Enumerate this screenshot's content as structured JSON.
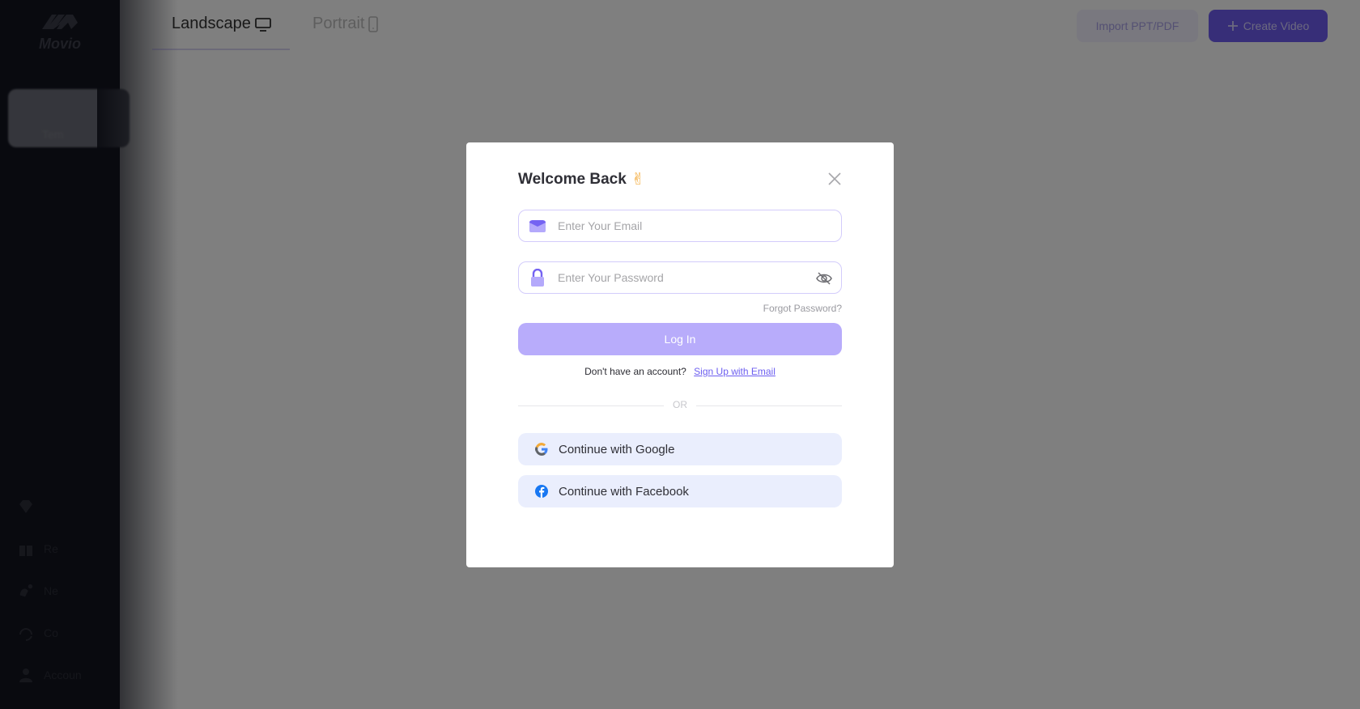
{
  "app": {
    "logo_text": "Movio"
  },
  "sidebar": {
    "active_item_label": "Tem",
    "bottom_items": [
      {
        "icon": "diamond-icon",
        "label": ""
      },
      {
        "icon": "gift-icon",
        "label": "Re"
      },
      {
        "icon": "affiliate-icon",
        "label": "Ne"
      },
      {
        "icon": "headset-icon",
        "label": "Co"
      },
      {
        "icon": "user-icon",
        "label": "Accoun"
      }
    ]
  },
  "topbar": {
    "tabs": [
      {
        "label": "Landscape",
        "icon": "monitor-icon",
        "active": true
      },
      {
        "label": "Portrait",
        "icon": "phone-icon",
        "active": false
      }
    ],
    "import_label": "Import PPT/PDF",
    "create_label": "Create Video"
  },
  "login_modal": {
    "title": "Welcome Back",
    "title_emoji": "✌",
    "email": {
      "value": "",
      "placeholder": "Enter Your Email"
    },
    "password": {
      "value": "",
      "placeholder": "Enter Your Password"
    },
    "forgot_label": "Forgot Password?",
    "login_label": "Log In",
    "signup_prompt": "Don't have an account?",
    "signup_link": "Sign Up with Email",
    "or_label": "OR",
    "google_label": "Continue with Google",
    "facebook_label": "Continue with Facebook",
    "colors": {
      "accent": "#6c5ef0",
      "login_button": "#b8acfb",
      "social_button_bg": "#eaeefd",
      "input_border": "#d3ccfb"
    }
  }
}
